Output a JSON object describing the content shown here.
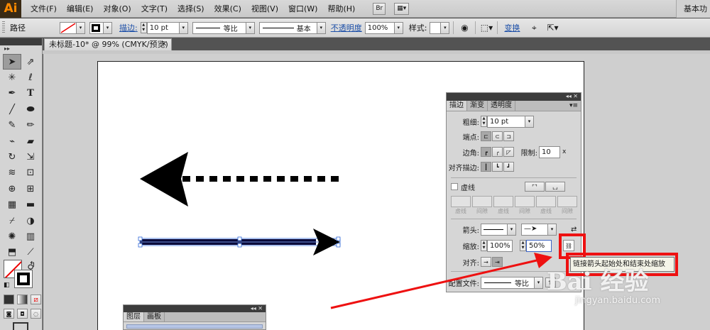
{
  "app": {
    "logo": "Ai",
    "workspace": "基本功"
  },
  "menu": [
    "文件(F)",
    "编辑(E)",
    "对象(O)",
    "文字(T)",
    "选择(S)",
    "效果(C)",
    "视图(V)",
    "窗口(W)",
    "帮助(H)"
  ],
  "menu_buttons": {
    "bridge": "Br",
    "arrange": "▦▾"
  },
  "control": {
    "selection_label": "路径",
    "stroke_label": "描边:",
    "stroke_weight": "10 pt",
    "profile": "等比",
    "brush": "基本",
    "opacity_label": "不透明度",
    "opacity": "100%",
    "style_label": "样式:",
    "transform_label": "变换"
  },
  "document": {
    "tab_title": "未标题-10* @ 99% (CMYK/预览)",
    "close": "✕"
  },
  "stroke_panel": {
    "collapse": "◂◂ ✕",
    "menu": "▾≡",
    "tabs": [
      "描边",
      "渐变",
      "透明度"
    ],
    "weight_label": "粗细:",
    "weight": "10 pt",
    "cap_label": "端点:",
    "corner_label": "边角:",
    "limit_label": "限制:",
    "limit": "10",
    "limit_unit": "x",
    "align_label": "对齐描边:",
    "dashed_label": "虚线",
    "dash_labels": [
      "虚线",
      "间隙",
      "虚线",
      "间隙",
      "虚线",
      "间隙"
    ],
    "arrow_label": "箭头:",
    "scale_label": "缩放:",
    "scale_start": "100%",
    "scale_end": "50%",
    "align_arrow_label": "对齐:",
    "profile_label": "配置文件:",
    "profile": "等比"
  },
  "tooltip": {
    "text": "链接箭头起始处和结束处缩放"
  },
  "layers_panel": {
    "collapse": "◂◂ ✕",
    "tabs": [
      "图层",
      "画板"
    ]
  },
  "watermark": {
    "brand": "Bai 经验",
    "url": "jingyan.baidu.com"
  },
  "colors": {
    "highlight": "#e11111",
    "canvas": "#ffffff",
    "ui": "#d6d6d6"
  }
}
